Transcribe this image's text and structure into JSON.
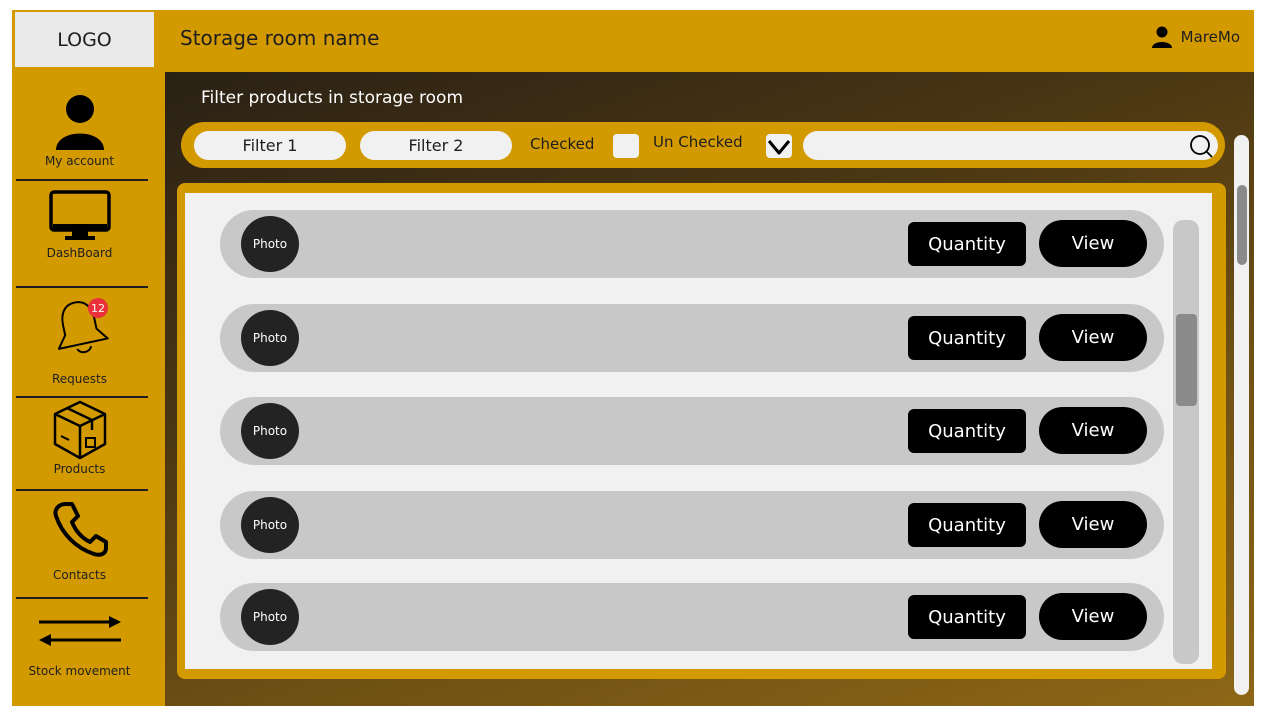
{
  "header": {
    "logo": "LOGO",
    "title": "Storage room name",
    "user": "MareMo"
  },
  "sidebar": {
    "items": [
      {
        "label": "My account",
        "icon": "user-icon"
      },
      {
        "label": "DashBoard",
        "icon": "monitor-icon"
      },
      {
        "label": "Requests",
        "icon": "bell-icon",
        "badge": "12"
      },
      {
        "label": "Products",
        "icon": "box-icon"
      },
      {
        "label": "Contacts",
        "icon": "phone-icon"
      },
      {
        "label": "Stock movement",
        "icon": "swap-arrows-icon"
      }
    ]
  },
  "filters": {
    "title": "Filter products in storage room",
    "filter1": "Filter 1",
    "filter2": "Filter 2",
    "checked_label": "Checked",
    "unchecked_label": "Un Checked",
    "search_value": ""
  },
  "products": [
    {
      "photo": "Photo",
      "quantity": "Quantity",
      "view": "View"
    },
    {
      "photo": "Photo",
      "quantity": "Quantity",
      "view": "View"
    },
    {
      "photo": "Photo",
      "quantity": "Quantity",
      "view": "View"
    },
    {
      "photo": "Photo",
      "quantity": "Quantity",
      "view": "View"
    },
    {
      "photo": "Photo",
      "quantity": "Quantity",
      "view": "View"
    }
  ],
  "colors": {
    "accent": "#d39a00",
    "panel": "#f1f1f1",
    "row": "#c8c8c8",
    "button": "#000000",
    "badge": "#e8313b"
  }
}
